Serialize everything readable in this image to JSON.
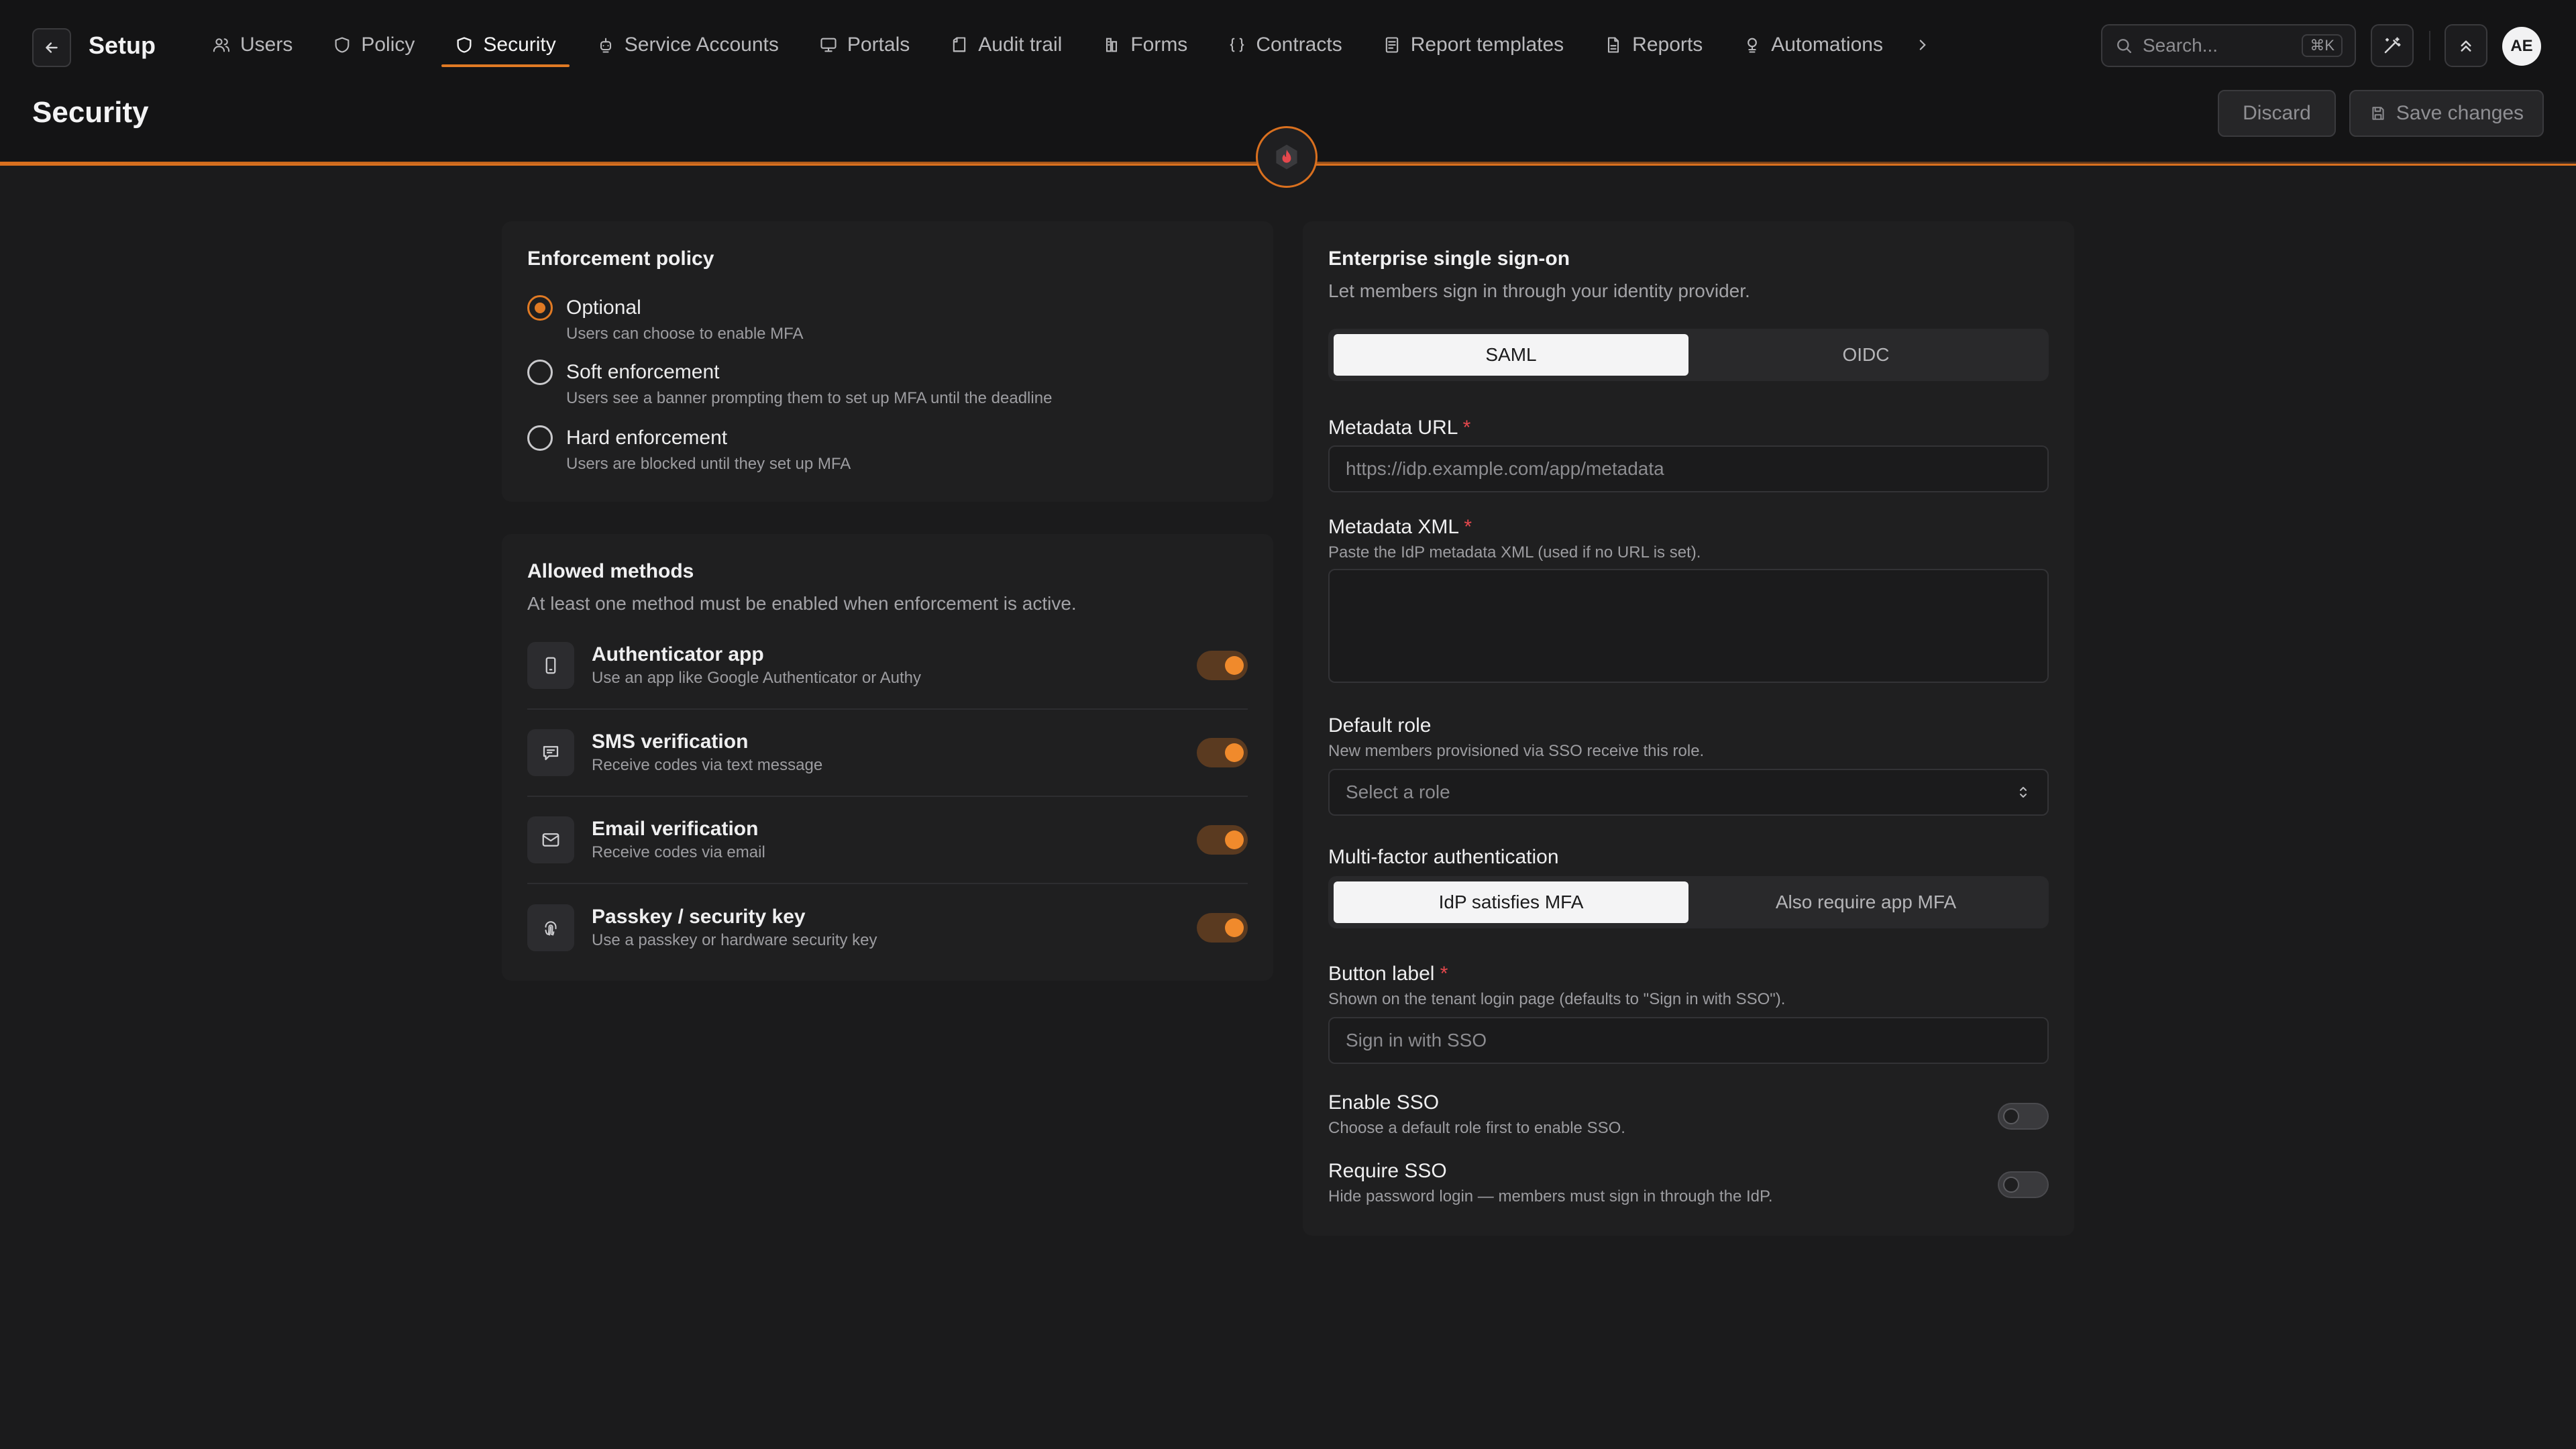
{
  "app": {
    "title": "Setup"
  },
  "nav": {
    "items": [
      {
        "label": "Users",
        "icon": "users-icon"
      },
      {
        "label": "Policy",
        "icon": "policy-icon"
      },
      {
        "label": "Security",
        "icon": "shield-icon",
        "active": true
      },
      {
        "label": "Service Accounts",
        "icon": "robot-icon"
      },
      {
        "label": "Portals",
        "icon": "monitor-icon"
      },
      {
        "label": "Audit trail",
        "icon": "audit-icon"
      },
      {
        "label": "Forms",
        "icon": "form-icon"
      },
      {
        "label": "Contracts",
        "icon": "braces-icon"
      },
      {
        "label": "Report templates",
        "icon": "template-icon"
      },
      {
        "label": "Reports",
        "icon": "document-icon"
      },
      {
        "label": "Automations",
        "icon": "automation-icon"
      }
    ]
  },
  "search": {
    "placeholder": "Search...",
    "shortcut": "⌘K"
  },
  "user": {
    "initials": "AE"
  },
  "page": {
    "title": "Security",
    "discard_label": "Discard",
    "save_label": "Save changes"
  },
  "enforcement": {
    "title": "Enforcement policy",
    "options": [
      {
        "label": "Optional",
        "desc": "Users can choose to enable MFA",
        "selected": true
      },
      {
        "label": "Soft enforcement",
        "desc": "Users see a banner prompting them to set up MFA until the deadline",
        "selected": false
      },
      {
        "label": "Hard enforcement",
        "desc": "Users are blocked until they set up MFA",
        "selected": false
      }
    ]
  },
  "methods": {
    "title": "Allowed methods",
    "subtitle": "At least one method must be enabled when enforcement is active.",
    "items": [
      {
        "label": "Authenticator app",
        "desc": "Use an app like Google Authenticator or Authy",
        "icon": "phone-icon",
        "enabled": true
      },
      {
        "label": "SMS verification",
        "desc": "Receive codes via text message",
        "icon": "message-icon",
        "enabled": true
      },
      {
        "label": "Email verification",
        "desc": "Receive codes via email",
        "icon": "mail-icon",
        "enabled": true
      },
      {
        "label": "Passkey / security key",
        "desc": "Use a passkey or hardware security key",
        "icon": "fingerprint-icon",
        "enabled": true
      }
    ]
  },
  "sso": {
    "title": "Enterprise single sign-on",
    "subtitle": "Let members sign in through your identity provider.",
    "protocols": [
      "SAML",
      "OIDC"
    ],
    "selected_protocol": "SAML",
    "metadata_url": {
      "label": "Metadata URL",
      "required": "*",
      "placeholder": "https://idp.example.com/app/metadata"
    },
    "metadata_xml": {
      "label": "Metadata XML",
      "required": "*",
      "help": "Paste the IdP metadata XML (used if no URL is set)."
    },
    "default_role": {
      "label": "Default role",
      "help": "New members provisioned via SSO receive this role.",
      "placeholder": "Select a role"
    },
    "mfa": {
      "label": "Multi-factor authentication",
      "options": [
        "IdP satisfies MFA",
        "Also require app MFA"
      ],
      "selected": "IdP satisfies MFA"
    },
    "button_label": {
      "label": "Button label",
      "required": "*",
      "help": "Shown on the tenant login page (defaults to \"Sign in with SSO\").",
      "placeholder": "Sign in with SSO"
    },
    "enable_sso": {
      "label": "Enable SSO",
      "help": "Choose a default role first to enable SSO.",
      "enabled": false
    },
    "require_sso": {
      "label": "Require SSO",
      "help": "Hide password login — members must sign in through the IdP.",
      "enabled": false
    }
  },
  "colors": {
    "accent": "#e07a24",
    "background": "#1b1b1c",
    "card": "#1f1f20"
  }
}
